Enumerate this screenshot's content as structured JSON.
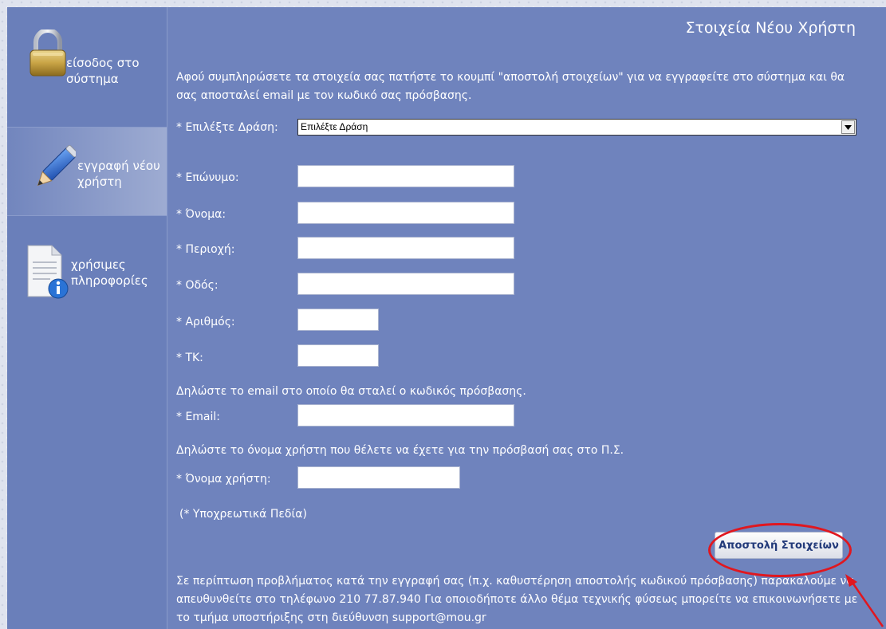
{
  "sidebar": {
    "items": [
      {
        "label": "είσοδος στο σύστημα",
        "icon": "padlock-icon"
      },
      {
        "label": "εγγραφή νέου χρήστη",
        "icon": "pencil-icon"
      },
      {
        "label": "χρήσιμες πληροφορίες",
        "icon": "info-document-icon"
      }
    ]
  },
  "main": {
    "title": "Στοιχεία Νέου Χρήστη",
    "intro": "Αφού συμπληρώσετε τα στοιχεία σας πατήστε το κουμπί \"αποστολή στοιχείων\" για να εγγραφείτε στο σύστημα και θα σας αποσταλεί email με τον κωδικό σας πρόσβασης.",
    "action": {
      "label": "* Επιλέξτε Δράση:",
      "selected": "Επιλέξτε Δράση"
    },
    "fields": {
      "surname": {
        "label": "* Επώνυμο:",
        "value": ""
      },
      "name": {
        "label": "* Όνομα:",
        "value": ""
      },
      "region": {
        "label": "* Περιοχή:",
        "value": ""
      },
      "street": {
        "label": "* Οδός:",
        "value": ""
      },
      "number": {
        "label": "* Αριθμός:",
        "value": ""
      },
      "zip": {
        "label": "* ΤΚ:",
        "value": ""
      },
      "email": {
        "label": "* Email:",
        "value": ""
      },
      "username": {
        "label": "* Όνομα χρήστη:",
        "value": ""
      }
    },
    "email_note": "Δηλώστε το email στο οποίο θα σταλεί ο κωδικός πρόσβασης.",
    "username_note": "Δηλώστε το όνομα χρήστη που θέλετε να έχετε για την πρόσβασή σας στο Π.Σ.",
    "required_note": "(*  Υποχρεωτικά Πεδία)",
    "submit_label": "Αποστολή Στοιχείων",
    "footer": "Σε περίπτωση προβλήματος κατά την εγγραφή σας (π.χ. καθυστέρηση αποστολής κωδικού πρόσβασης) παρακαλούμε να απευθυνθείτε στο τηλέφωνο 210 77.87.940 Για οποιοδήποτε άλλο θέμα τεχνικής φύσεως μπορείτε να επικοινωνήσετε με το τμήμα υποστήριξης στη διεύθυνση support@mou.gr"
  },
  "colors": {
    "panel": "#6f83bd",
    "sidebar": "#6a7fba",
    "annotation": "#e0171f"
  }
}
